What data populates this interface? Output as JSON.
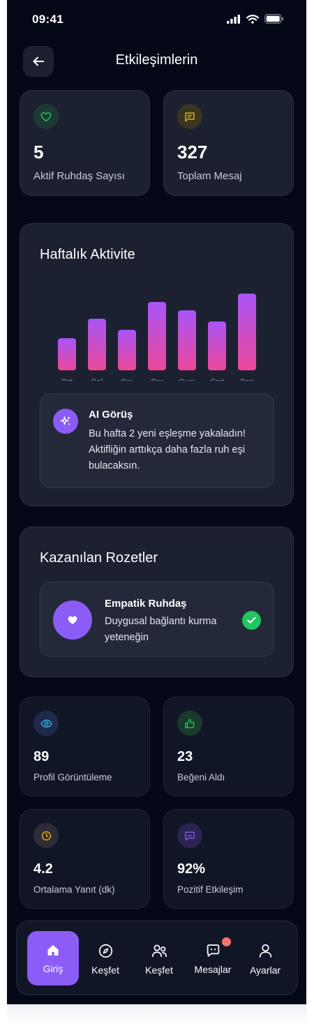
{
  "status_bar": {
    "time": "09:41"
  },
  "header": {
    "title": "Etkileşimlerin"
  },
  "top_stats": [
    {
      "value": "5",
      "label": "Aktif Ruhdaş Sayısı",
      "icon": "heart-icon",
      "color": "#22c55e"
    },
    {
      "value": "327",
      "label": "Toplam Mesaj",
      "icon": "message-icon",
      "color": "#eab308"
    }
  ],
  "weekly": {
    "title": "Haftalık Aktivite",
    "chart_data": {
      "type": "bar",
      "categories": [
        "Pzt",
        "Sal",
        "Çar",
        "Per",
        "Cum",
        "Cmt",
        "Paz"
      ],
      "values": [
        46,
        74,
        58,
        98,
        86,
        70,
        110
      ],
      "gradient": [
        "#a855f7",
        "#ec4899"
      ]
    }
  },
  "insight": {
    "title": "AI Görüş",
    "text": "Bu hafta 2 yeni eşleşme yakaladın! Aktifliğin arttıkça daha fazla ruh eşi bulacaksın."
  },
  "badges": {
    "title": "Kazanılan Rozetler",
    "item": {
      "title": "Empatik Ruhdaş",
      "text": "Duygusal bağlantı kurma yeteneğin"
    }
  },
  "bottom_stats": [
    {
      "value": "89",
      "label": "Profil Görüntüleme",
      "icon": "eye-icon",
      "color": "#38bdf8"
    },
    {
      "value": "23",
      "label": "Beğeni Aldı",
      "icon": "thumbs-up-icon",
      "color": "#22c55e"
    },
    {
      "value": "4.2",
      "label": "Ortalama Yanıt (dk)",
      "icon": "clock-icon",
      "color": "#eab308"
    },
    {
      "value": "92%",
      "label": "Pozitif Etkileşim",
      "icon": "smile-message-icon",
      "color": "#8b5cf6"
    }
  ],
  "nav": [
    {
      "label": "Giriş",
      "icon": "home-icon",
      "active": true
    },
    {
      "label": "Keşfet",
      "icon": "compass-icon"
    },
    {
      "label": "Keşfet",
      "icon": "users-icon"
    },
    {
      "label": "Mesajlar",
      "icon": "chat-icon"
    },
    {
      "label": "Ayarlar",
      "icon": "user-icon"
    }
  ]
}
